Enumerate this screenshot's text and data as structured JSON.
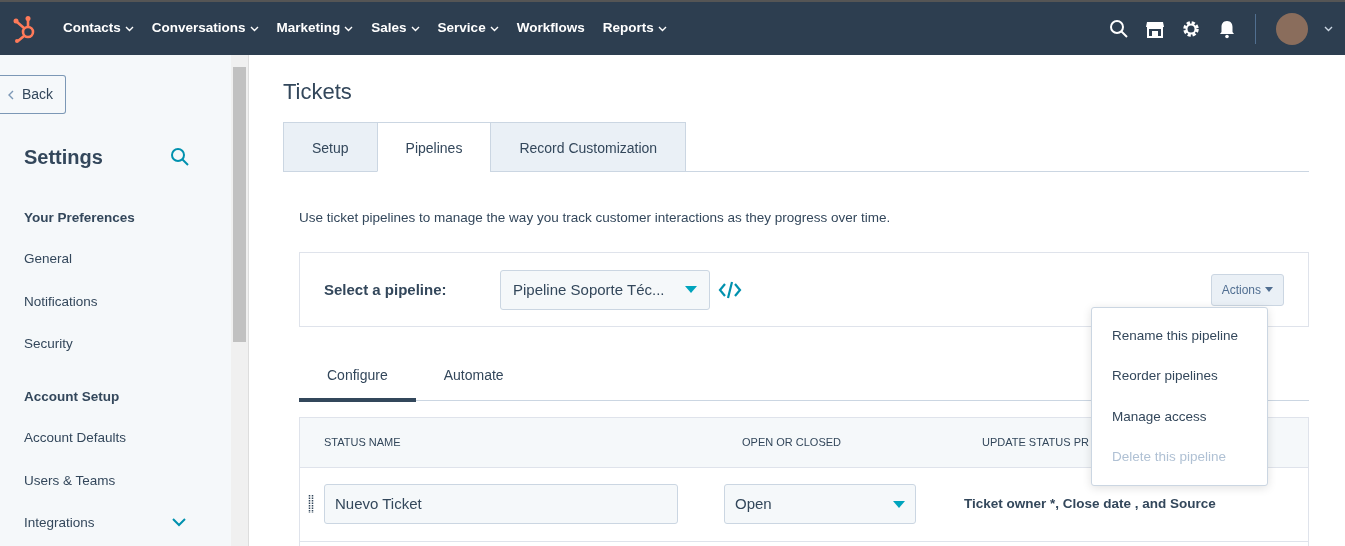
{
  "top_nav": {
    "items": [
      {
        "label": "Contacts",
        "dropdown": true
      },
      {
        "label": "Conversations",
        "dropdown": true
      },
      {
        "label": "Marketing",
        "dropdown": true
      },
      {
        "label": "Sales",
        "dropdown": true
      },
      {
        "label": "Service",
        "dropdown": true
      },
      {
        "label": "Workflows",
        "dropdown": false
      },
      {
        "label": "Reports",
        "dropdown": true
      }
    ]
  },
  "sidebar": {
    "back": "Back",
    "title": "Settings",
    "sections": [
      {
        "heading": "Your Preferences",
        "items": [
          {
            "label": "General",
            "expandable": false
          },
          {
            "label": "Notifications",
            "expandable": false
          },
          {
            "label": "Security",
            "expandable": false
          }
        ]
      },
      {
        "heading": "Account Setup",
        "items": [
          {
            "label": "Account Defaults",
            "expandable": false
          },
          {
            "label": "Users & Teams",
            "expandable": false
          },
          {
            "label": "Integrations",
            "expandable": true
          }
        ]
      }
    ]
  },
  "page": {
    "title": "Tickets",
    "tabs": [
      {
        "label": "Setup",
        "selected": false
      },
      {
        "label": "Pipelines",
        "selected": true
      },
      {
        "label": "Record Customization",
        "selected": false
      }
    ],
    "description": "Use ticket pipelines to manage the way you track customer interactions as they progress over time.",
    "pipeline_label": "Select a pipeline:",
    "pipeline_value": "Pipeline Soporte Téc...",
    "actions_button": "Actions",
    "actions_menu": [
      {
        "label": "Rename this pipeline",
        "disabled": false
      },
      {
        "label": "Reorder pipelines",
        "disabled": false
      },
      {
        "label": "Manage access",
        "disabled": false
      },
      {
        "label": "Delete this pipeline",
        "disabled": true
      }
    ],
    "subtabs": [
      {
        "label": "Configure",
        "selected": true
      },
      {
        "label": "Automate",
        "selected": false
      }
    ],
    "table": {
      "columns": [
        "STATUS NAME",
        "OPEN OR CLOSED",
        "UPDATE STATUS PR"
      ],
      "rows": [
        {
          "status_name": "Nuevo Ticket",
          "open_or_closed": "Open",
          "properties": "Ticket owner *, Close date , and Source"
        }
      ]
    }
  }
}
